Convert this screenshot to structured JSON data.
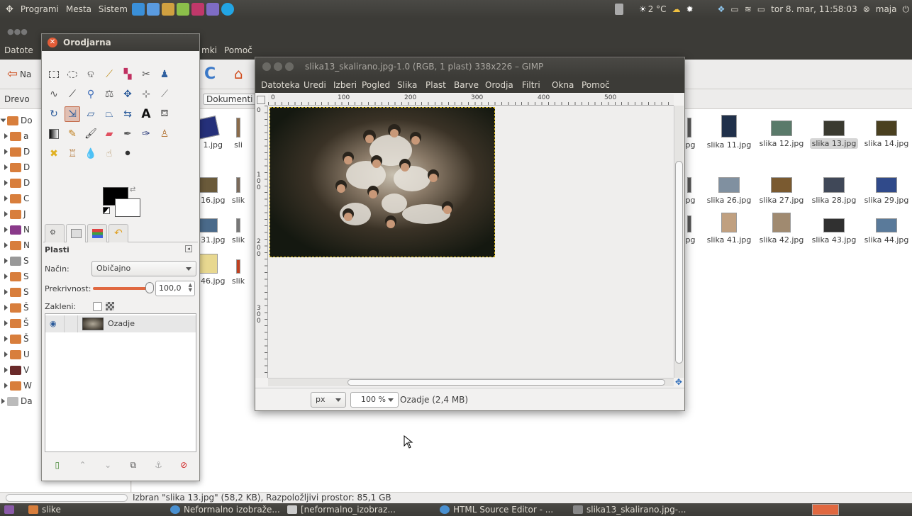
{
  "top_panel": {
    "menu": [
      "Programi",
      "Mesta",
      "Sistem"
    ],
    "weather": "2 °C",
    "clock": "tor 8. mar, 11:58:03",
    "user": "maja"
  },
  "nautilus": {
    "menu": [
      "Datote",
      "mki",
      "Pomoč"
    ],
    "back_label": "Na",
    "view_label": "Drevo",
    "path_button": "Dokumenti",
    "tree": [
      "Do",
      "a",
      "D",
      "D",
      "D",
      "C",
      "J",
      "N",
      "N",
      "S",
      "S",
      "S",
      "Š",
      "Š",
      "Š",
      "U",
      "V",
      "W",
      "Da"
    ],
    "thumbs_row1": [
      "ka 1.jpg",
      "sli",
      "jpg",
      "slika 11.jpg",
      "slika 12.jpg",
      "slika 13.jpg",
      "slika 14.jpg"
    ],
    "thumbs_row2": [
      "ka 16.jpg",
      "slik",
      "jpg",
      "slika 26.jpg",
      "slika 27.jpg",
      "slika 28.jpg",
      "slika 29.jpg"
    ],
    "thumbs_row3": [
      "ka 31.jpg",
      "slik",
      "jpg",
      "slika 41.jpg",
      "slika 42.jpg",
      "slika 43.jpg",
      "slika 44.jpg"
    ],
    "thumbs_row4": [
      "ka 46.jpg",
      "slik"
    ],
    "statusbar": "Izbran \"slika 13.jpg\" (58,2 KB), Razpoložljivi prostor: 85,1 GB"
  },
  "toolbox": {
    "title": "Orodjarna",
    "layers_title": "Plasti",
    "mode_label": "Način:",
    "mode_value": "Običajno",
    "opacity_label": "Prekrivnost:",
    "opacity_value": "100,0",
    "opacity_level": 1.0,
    "lock_label": "Zakleni:",
    "layer_name": "Ozadje"
  },
  "image_window": {
    "title": "slika13_skalirano.jpg-1.0 (RGB, 1 plast) 338x226 – GIMP",
    "menu": [
      "Datoteka",
      "Uredi",
      "Izberi",
      "Pogled",
      "Slika",
      "Plast",
      "Barve",
      "Orodja",
      "Filtri",
      "Okna",
      "Pomoč"
    ],
    "ruler_ticks": [
      "0",
      "100",
      "200",
      "300",
      "400",
      "500"
    ],
    "ruler_left_ticks": [
      "0",
      "1 0 0",
      "2 0 0",
      "3 0 0"
    ],
    "unit": "px",
    "zoom": "100 %",
    "status": "Ozadje (2,4 MB)"
  },
  "taskbar": {
    "items": [
      "slike",
      "Neformalno izobraže...",
      "[neformalno_izobraz...",
      "HTML Source Editor - ...",
      "slika13_skalirano.jpg-..."
    ]
  }
}
